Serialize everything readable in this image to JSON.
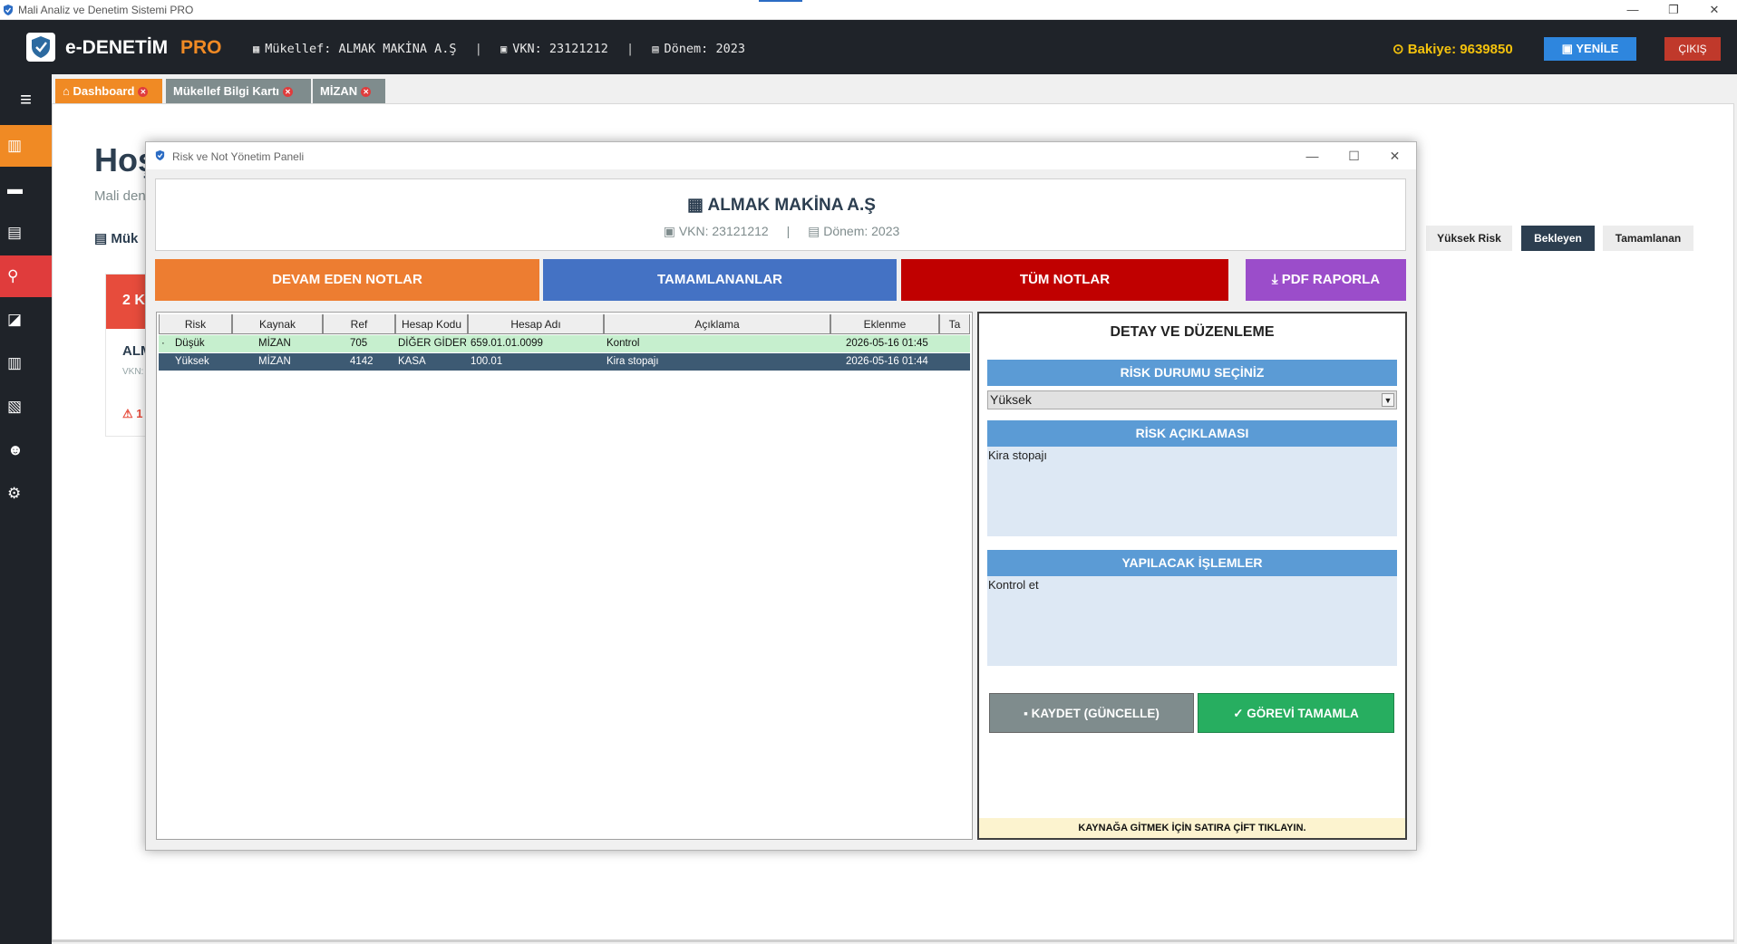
{
  "os": {
    "window_title": "Mali Analiz ve Denetim Sistemi PRO",
    "min_glyph": "—",
    "restore_glyph": "❐",
    "close_glyph": "✕"
  },
  "header": {
    "brand": "e-DENETİM",
    "brand_suffix": "PRO",
    "taxpayer": "Mükellef: ALMAK MAKİNA A.Ş",
    "vkn": "VKN: 23121212",
    "period": "Dönem: 2023",
    "separator": "|",
    "balance": "Bakiye: 9639850",
    "refresh": "YENİLE",
    "logout": "ÇIKIŞ"
  },
  "tabs": [
    {
      "label": "Dashboard",
      "close": "✕"
    },
    {
      "label": "Mükellef Bilgi Kartı",
      "close": "✕"
    },
    {
      "label": "MİZAN",
      "close": "✕"
    }
  ],
  "dashboard": {
    "title": "Hoş",
    "subtitle": "Mali den",
    "section": "Mük",
    "card_head": "2 K",
    "card_name": "ALM",
    "card_vkn": "VKN:",
    "card_warn": "1",
    "filters": [
      "Yüksek Risk",
      "Bekleyen",
      "Tamamlanan"
    ]
  },
  "dialog": {
    "title": "Risk ve Not Yönetim Paneli",
    "company": "ALMAK MAKİNA A.Ş",
    "vkn": "VKN: 23121212",
    "period": "Dönem: 2023",
    "separator": "|",
    "buttons": {
      "ongoing": "DEVAM EDEN NOTLAR",
      "completed": "TAMAMLANANLAR",
      "all": "TÜM NOTLAR",
      "pdf": "PDF RAPORLA"
    },
    "grid": {
      "columns": [
        "Risk",
        "Kaynak",
        "Ref",
        "Hesap Kodu",
        "Hesap Adı",
        "Açıklama",
        "Eklenme",
        "Ta"
      ],
      "rows": [
        {
          "marker": "·",
          "risk": "Düşük",
          "source": "MİZAN",
          "ref": "705",
          "code": "DİĞER GİDER V",
          "name": "659.01.01.0099",
          "desc": "Kontrol",
          "added": "2026-05-16 01:45"
        },
        {
          "marker": "",
          "risk": "Yüksek",
          "source": "MİZAN",
          "ref": "4142",
          "code": "KASA",
          "name": "100.01",
          "desc": "Kira stopajı",
          "added": "2026-05-16 01:44"
        }
      ]
    },
    "detail": {
      "title": "DETAY VE DÜZENLEME",
      "risk_status_label": "RİSK DURUMU SEÇİNİZ",
      "risk_status_value": "Yüksek",
      "risk_desc_label": "RİSK AÇIKLAMASI",
      "risk_desc_value": "Kira stopajı",
      "todo_label": "YAPILACAK İŞLEMLER",
      "todo_value": "Kontrol et",
      "save": "KAYDET (GÜNCELLE)",
      "complete": "GÖREVİ TAMAMLA",
      "hint": "KAYNAĞA GİTMEK İÇİN SATIRA ÇİFT TIKLAYIN."
    }
  },
  "colors": {
    "header_bg": "#1f2329",
    "accent_orange": "#f08a24",
    "sidebar_active": "#f08a24",
    "sidebar_search": "#e03c3c",
    "row_low": "#c6efce",
    "row_selected": "#3d5a73",
    "btn_ongoing": "#ed7d31",
    "btn_completed": "#4472c4",
    "btn_all": "#c00000",
    "btn_pdf": "#9b4dca"
  }
}
